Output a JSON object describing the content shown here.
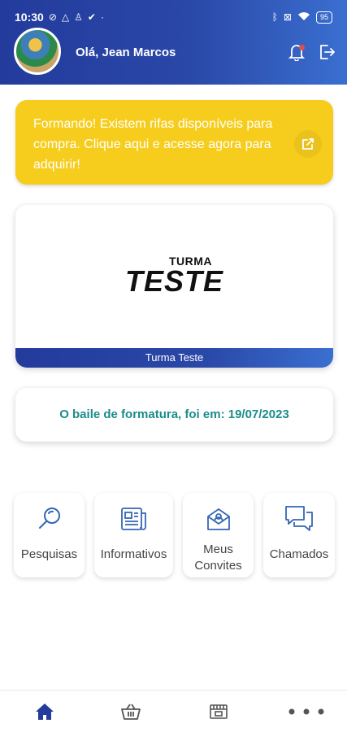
{
  "status": {
    "time": "10:30",
    "battery": "95",
    "left_icons": [
      "sync-off-icon",
      "drive-icon",
      "accessibility-icon",
      "check-circle-icon"
    ],
    "right_icons": [
      "bluetooth-icon",
      "mute-icon",
      "wifi-icon",
      "battery-icon"
    ]
  },
  "header": {
    "greeting": "Olá, Jean Marcos",
    "icons": [
      "bell-icon",
      "logout-icon"
    ]
  },
  "banner": {
    "text": "Formando! Existem rifas disponíveis para compra. Clique aqui e acesse agora para adquirir!",
    "icon": "external-link-icon",
    "color": "#f7cd1d"
  },
  "turma": {
    "logo_small": "TURMA",
    "logo_big": "TESTE",
    "name": "Turma Teste"
  },
  "baile": {
    "text": "O baile de formatura, foi em: 19/07/2023",
    "color": "#1b8c8c"
  },
  "menu": [
    {
      "label": "Pesquisas",
      "icon": "search-icon"
    },
    {
      "label": "Informativos",
      "icon": "newspaper-icon"
    },
    {
      "label": "Meus Convites",
      "icon": "invite-envelope-icon"
    },
    {
      "label": "Chamados",
      "icon": "chat-icon"
    }
  ],
  "bottom_nav": [
    {
      "icon": "home-icon",
      "active": true
    },
    {
      "icon": "basket-icon",
      "active": false
    },
    {
      "icon": "ticket-icon",
      "active": false
    },
    {
      "icon": "more-icon",
      "active": false
    }
  ],
  "colors": {
    "primary": "#233b9c",
    "accent": "#3a6fd0",
    "icon_blue": "#3566b5"
  }
}
